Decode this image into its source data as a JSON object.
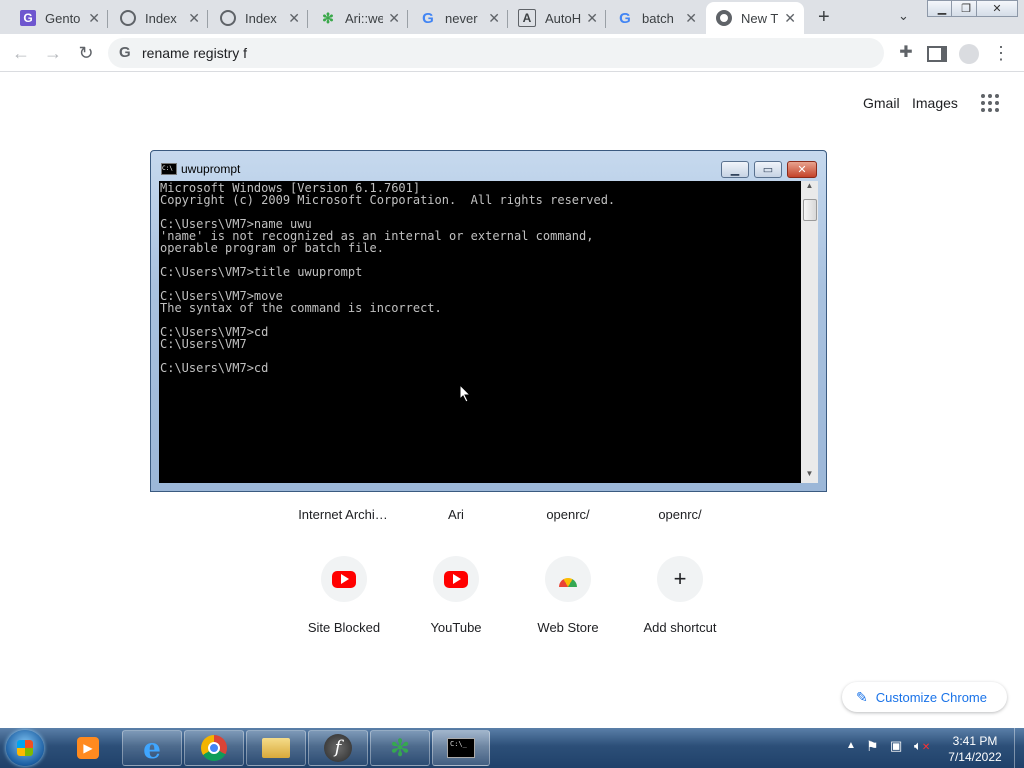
{
  "tabs": [
    {
      "title": "Gento",
      "icon": "gentoo-icon",
      "active": false
    },
    {
      "title": "Index",
      "icon": "globe-icon",
      "active": false
    },
    {
      "title": "Index",
      "icon": "globe-icon",
      "active": false
    },
    {
      "title": "Ari::we",
      "icon": "puzzle-icon",
      "active": false
    },
    {
      "title": "never",
      "icon": "google-icon",
      "active": false
    },
    {
      "title": "AutoH",
      "icon": "autohotkey-icon",
      "active": false
    },
    {
      "title": "batch",
      "icon": "google-icon",
      "active": false
    },
    {
      "title": "New T",
      "icon": "chrome-icon",
      "active": true
    }
  ],
  "omnibox": {
    "text": "rename registry f"
  },
  "header_links": {
    "gmail": "Gmail",
    "images": "Images"
  },
  "top_shortcuts": [
    "Internet Archi…",
    "Ari",
    "openrc/",
    "openrc/"
  ],
  "shortcuts": [
    {
      "label": "Site Blocked",
      "icon": "youtube-icon"
    },
    {
      "label": "YouTube",
      "icon": "youtube-icon"
    },
    {
      "label": "Web Store",
      "icon": "webstore-icon"
    },
    {
      "label": "Add shortcut",
      "icon": "plus-icon"
    }
  ],
  "customize": {
    "label": "Customize Chrome"
  },
  "console": {
    "title": "uwuprompt",
    "text": "Microsoft Windows [Version 6.1.7601]\nCopyright (c) 2009 Microsoft Corporation.  All rights reserved.\n\nC:\\Users\\VM7>name uwu\n'name' is not recognized as an internal or external command,\noperable program or batch file.\n\nC:\\Users\\VM7>title uwuprompt\n\nC:\\Users\\VM7>move\nThe syntax of the command is incorrect.\n\nC:\\Users\\VM7>cd\nC:\\Users\\VM7\n\nC:\\Users\\VM7>cd"
  },
  "taskbar": {
    "items": [
      "start-orb-icon",
      "media-player-icon",
      "internet-explorer-icon",
      "chrome-icon",
      "file-explorer-icon",
      "flash-icon",
      "puzzle-app-icon",
      "cmd-icon"
    ],
    "time": "3:41 PM",
    "date": "7/14/2022"
  },
  "colors": {
    "accent": "#1a73e8",
    "tabstrip": "#dee1e6",
    "console_bg": "#000000",
    "console_fg": "#c0c0c0",
    "taskbar": "#2c4f78"
  }
}
